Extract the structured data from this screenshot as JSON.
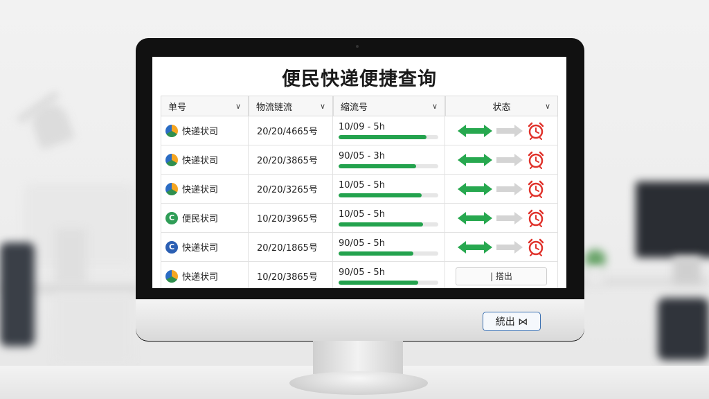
{
  "page": {
    "title": "便民快递便捷查询"
  },
  "table": {
    "headers": [
      {
        "label": "单号"
      },
      {
        "label": "物流链流"
      },
      {
        "label": "縮流号"
      },
      {
        "label": "状态"
      }
    ],
    "rows": [
      {
        "company": "快递状司",
        "logo": "logo-a-icon",
        "number": "20/20/4665号",
        "progress_label": "10/09 - 5h",
        "progress": 0.88,
        "status": "arrows-alarm"
      },
      {
        "company": "快递状司",
        "logo": "logo-a-icon",
        "number": "20/20/3865号",
        "progress_label": "90/05 - 3h",
        "progress": 0.78,
        "status": "arrows-alarm"
      },
      {
        "company": "快递状司",
        "logo": "logo-a-icon",
        "number": "20/20/3265号",
        "progress_label": "10/05 - 5h",
        "progress": 0.83,
        "status": "arrows-alarm"
      },
      {
        "company": "便民状司",
        "logo": "logo-green-icon",
        "number": "10/20/3965号",
        "progress_label": "10/05 - 5h",
        "progress": 0.85,
        "status": "arrows-alarm"
      },
      {
        "company": "快递状司",
        "logo": "logo-blue-icon",
        "number": "20/20/1865号",
        "progress_label": "90/05 - 5h",
        "progress": 0.75,
        "status": "arrows-alarm"
      },
      {
        "company": "快递状司",
        "logo": "logo-a-icon",
        "number": "10/20/3865号",
        "progress_label": "90/05 - 5h",
        "progress": 0.8,
        "status": "button",
        "button_label": "| 搭出"
      }
    ]
  },
  "chin_button": {
    "label": "統出 ⋈"
  },
  "colors": {
    "progress_fill": "#23a24d",
    "arrow_green": "#27a84f",
    "alarm_red": "#e0322b",
    "chin_button_border": "#3a6fb0"
  }
}
